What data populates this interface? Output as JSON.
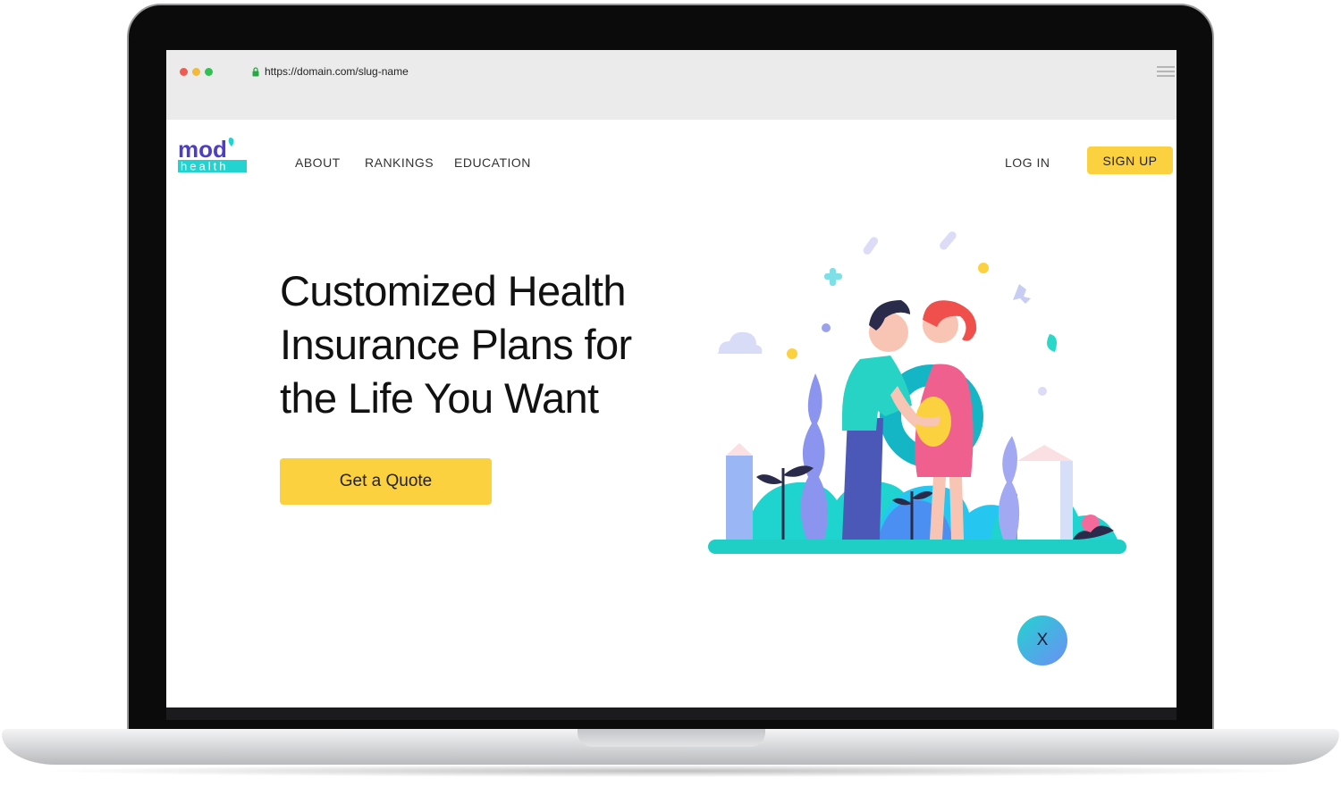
{
  "browser": {
    "url": "https://domain.com/slug-name"
  },
  "logo": {
    "top_text": "mod",
    "bottom_text": "health"
  },
  "nav": {
    "links": [
      "ABOUT",
      "RANKINGS",
      "EDUCATION"
    ],
    "login_label": "LOG IN",
    "signup_label": "SIGN UP"
  },
  "hero": {
    "title": "Customized Health Insurance Plans for the Life You Want",
    "cta_label": "Get a Quote",
    "illustration_icon": "couple-pregnancy-illustration"
  },
  "close_button": {
    "label": "X"
  },
  "colors": {
    "accent_yellow": "#fcd13f",
    "brand_teal": "#1fd4cf",
    "brand_purple": "#6a4fd8"
  }
}
